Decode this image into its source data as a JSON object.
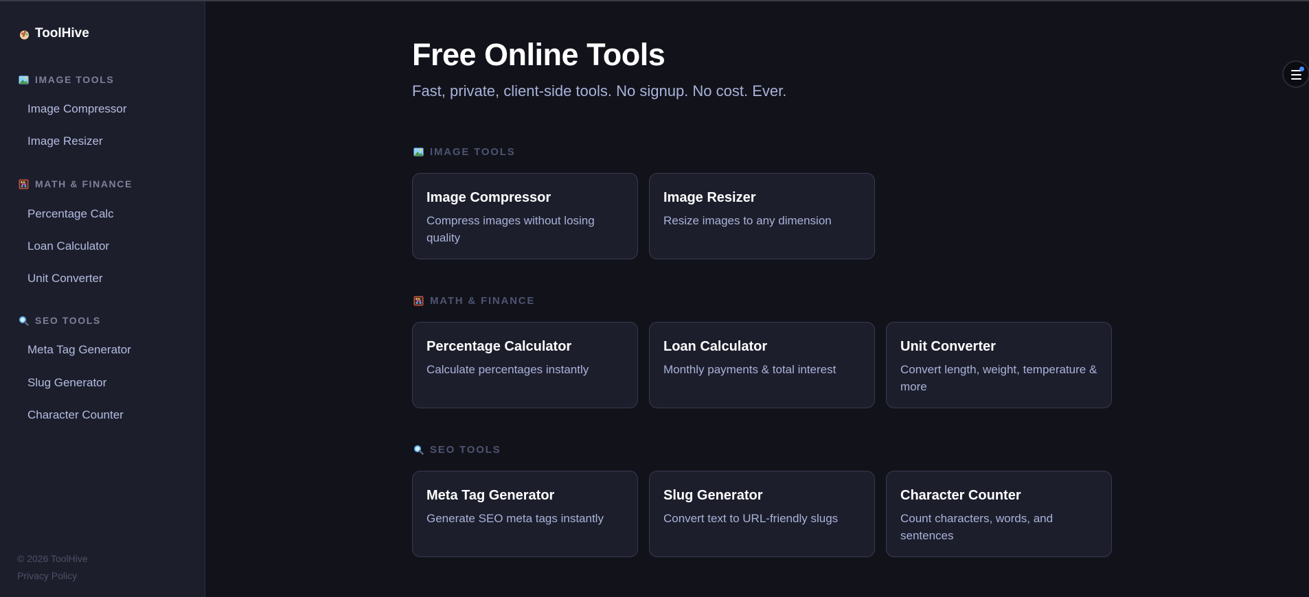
{
  "brand": {
    "name": "ToolHive",
    "icon": "palette-icon"
  },
  "sidebar": {
    "sections": [
      {
        "heading": "IMAGE TOOLS",
        "icon": "picture-icon",
        "items": [
          "Image Compressor",
          "Image Resizer"
        ]
      },
      {
        "heading": "MATH & FINANCE",
        "icon": "abacus-icon",
        "items": [
          "Percentage Calc",
          "Loan Calculator",
          "Unit Converter"
        ]
      },
      {
        "heading": "SEO TOOLS",
        "icon": "magnifier-icon",
        "items": [
          "Meta Tag Generator",
          "Slug Generator",
          "Character Counter"
        ]
      }
    ],
    "footer": {
      "copyright": "© 2026 ToolHive",
      "privacy": "Privacy Policy"
    }
  },
  "main": {
    "title": "Free Online Tools",
    "subtitle": "Fast, private, client-side tools. No signup. No cost. Ever.",
    "categories": [
      {
        "heading": "IMAGE TOOLS",
        "icon": "picture-icon",
        "cards": [
          {
            "title": "Image Compressor",
            "desc": "Compress images without losing quality"
          },
          {
            "title": "Image Resizer",
            "desc": "Resize images to any dimension"
          }
        ]
      },
      {
        "heading": "MATH & FINANCE",
        "icon": "abacus-icon",
        "cards": [
          {
            "title": "Percentage Calculator",
            "desc": "Calculate percentages instantly"
          },
          {
            "title": "Loan Calculator",
            "desc": "Monthly payments & total interest"
          },
          {
            "title": "Unit Converter",
            "desc": "Convert length, weight, temperature & more"
          }
        ]
      },
      {
        "heading": "SEO TOOLS",
        "icon": "magnifier-icon",
        "cards": [
          {
            "title": "Meta Tag Generator",
            "desc": "Generate SEO meta tags instantly"
          },
          {
            "title": "Slug Generator",
            "desc": "Convert text to URL-friendly slugs"
          },
          {
            "title": "Character Counter",
            "desc": "Count characters, words, and sentences"
          }
        ]
      }
    ]
  },
  "menu_button": {
    "icon": "hamburger-menu-icon",
    "notification": "notification-dot"
  },
  "colors": {
    "background": "#12121b",
    "sidebar": "#1d1e2c",
    "card": "#1d1e2c",
    "card_border": "#383a4f",
    "accent": "#4a8bff",
    "muted_text": "#a9b3d9"
  }
}
